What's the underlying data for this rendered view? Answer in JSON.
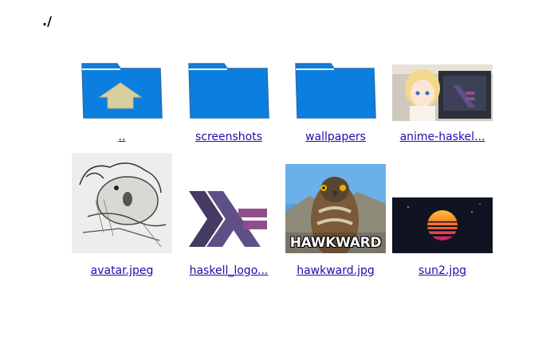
{
  "path": "./",
  "folders": [
    {
      "name": "..",
      "icon": "folder-up-icon"
    },
    {
      "name": "screenshots",
      "icon": "folder-icon"
    },
    {
      "name": "wallpapers",
      "icon": "folder-icon"
    }
  ],
  "files": [
    {
      "name": "anime-haskel...",
      "icon": "image-thumbnail"
    },
    {
      "name": "avatar.jpeg",
      "icon": "image-thumbnail"
    },
    {
      "name": "haskell_logo...",
      "icon": "image-thumbnail"
    },
    {
      "name": "hawkward.jpg",
      "icon": "image-thumbnail"
    },
    {
      "name": "sun2.jpg",
      "icon": "image-thumbnail"
    }
  ],
  "hawkward_text": "HAWKWARD",
  "colors": {
    "folder": "#0a7fe0",
    "link": "#1a0dab",
    "haskell_dark": "#453a62",
    "haskell_mid": "#5e5086",
    "haskell_light": "#8f4e8b"
  }
}
